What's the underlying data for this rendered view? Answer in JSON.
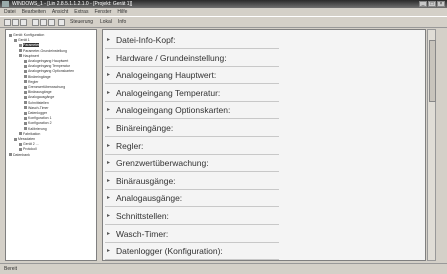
{
  "window": {
    "title": "WINDOWS_1 - [Lin 2.8.5.1.1.2.1.0 - [Projekt: Gerät 1]]",
    "menus": [
      "Datei",
      "Bearbeiten",
      "Ansicht",
      "Extras",
      "Fenster",
      "Hilfe"
    ]
  },
  "toolbar": {
    "labels": [
      "Steuerung",
      "Lokal",
      "Info"
    ]
  },
  "tree": {
    "items": [
      {
        "label": "Gerät: Konfiguration",
        "indent": 0
      },
      {
        "label": "Gerät 1",
        "indent": 1
      },
      {
        "label": "Parameter",
        "indent": 2,
        "selected": true
      },
      {
        "label": "Parameter-Grundeinstellung",
        "indent": 2
      },
      {
        "label": "Hauptwert",
        "indent": 2
      },
      {
        "label": "Analogeingang Hauptwert",
        "indent": 3
      },
      {
        "label": "Analogeingang Temperatur",
        "indent": 3
      },
      {
        "label": "Analogeingang Optionskarten",
        "indent": 3
      },
      {
        "label": "Binäreingänge",
        "indent": 3
      },
      {
        "label": "Regler",
        "indent": 3
      },
      {
        "label": "Grenzwertüberwachung",
        "indent": 3
      },
      {
        "label": "Binärausgänge",
        "indent": 3
      },
      {
        "label": "Analogausgänge",
        "indent": 3
      },
      {
        "label": "Schnittstellen",
        "indent": 3
      },
      {
        "label": "Wasch-Timer",
        "indent": 3
      },
      {
        "label": "Datenlogger",
        "indent": 3
      },
      {
        "label": "Konfiguration 1",
        "indent": 3
      },
      {
        "label": "Konfiguration 2",
        "indent": 3
      },
      {
        "label": "Kalibrierung",
        "indent": 3
      },
      {
        "label": "Fabrikation",
        "indent": 2
      },
      {
        "label": "Messdaten",
        "indent": 1
      },
      {
        "label": "Gerät 2 ...",
        "indent": 2
      },
      {
        "label": "Protokoll",
        "indent": 2
      },
      {
        "label": "Datenbank",
        "indent": 0
      }
    ]
  },
  "main": {
    "sections": [
      "Datei-Info-Kopf:",
      "Hardware / Grundeinstellung:",
      "Analogeingang Hauptwert:",
      "Analogeingang Temperatur:",
      "Analogeingang Optionskarten:",
      "Binäreingänge:",
      "Regler:",
      "Grenzwertüberwachung:",
      "Binärausgänge:",
      "Analogausgänge:",
      "Schnittstellen:",
      "Wasch-Timer:",
      "Datenlogger (Konfiguration):"
    ]
  },
  "status": {
    "text": "Bereit"
  }
}
